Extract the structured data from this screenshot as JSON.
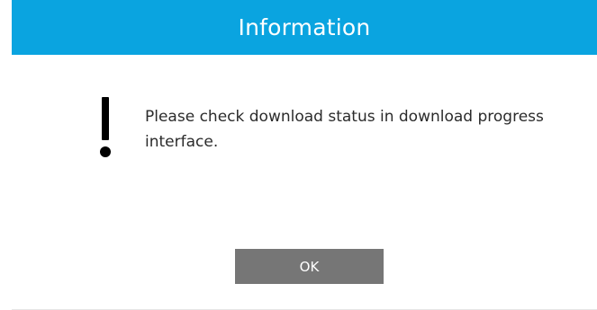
{
  "dialog": {
    "title": "Information",
    "message": "Please check download status in download progress interface.",
    "icon": "exclamation-icon",
    "ok_label": "OK"
  },
  "colors": {
    "title_bar": "#0aa4e0",
    "button": "#767676",
    "text": "#2b2b2b"
  }
}
